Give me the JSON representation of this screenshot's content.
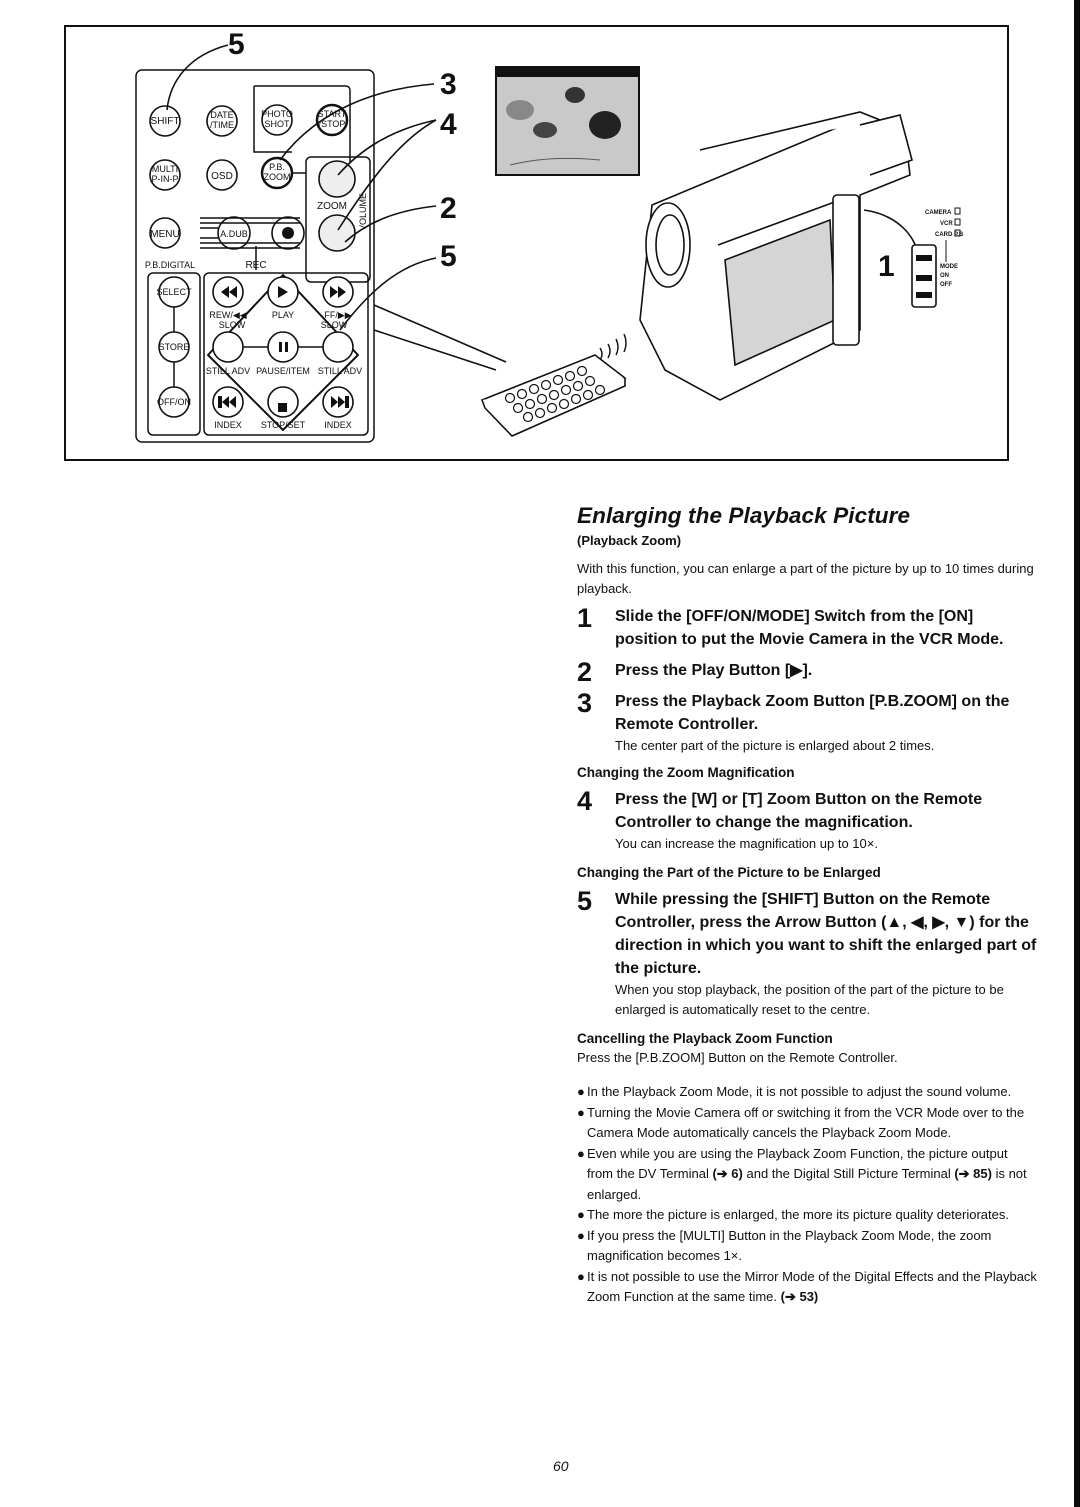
{
  "figure": {
    "callouts": {
      "top_left_5": "5",
      "right_3": "3",
      "right_4": "4",
      "right_2": "2",
      "right_5": "5",
      "switch_1": "1"
    },
    "remote_buttons": {
      "shift": "SHIFT",
      "date_time": [
        "DATE",
        "/TIME"
      ],
      "photo_shot": [
        "PHOTO",
        "SHOT"
      ],
      "start_stop": [
        "START",
        "/STOP"
      ],
      "multi": [
        "MULTI",
        "P-IN-P"
      ],
      "osd": "OSD",
      "pb_zoom": [
        "P.B.",
        "ZOOM"
      ],
      "zoom_label": "ZOOM",
      "volume_label": "VOLUME",
      "menu": "MENU",
      "a_dub": "A.DUB",
      "rec_label": "REC",
      "pb_digital_label": "P.B.DIGITAL",
      "select": "SELECT",
      "store": "STORE",
      "off_on": "OFF/ON",
      "rew_label": "REW/◀◀",
      "play_label": "PLAY",
      "ff_label": "FF/▶▶",
      "slow_left": "SLOW",
      "slow_right": "SLOW",
      "still_adv_left": "STILL ADV",
      "pause_item": "PAUSE/ITEM",
      "still_adv_right": "STILL ADV",
      "index_left": "INDEX",
      "stop_set": "STOP/SET",
      "index_right": "INDEX"
    },
    "switch_labels": {
      "camera": "CAMERA",
      "vcr": "VCR",
      "card_pb": "CARD P.B",
      "mode": "MODE",
      "on": "ON",
      "off": "OFF"
    }
  },
  "article": {
    "title": "Enlarging the Playback Picture",
    "subtitle": "(Playback Zoom)",
    "intro": "With this function, you can enlarge a part of the picture by up to 10 times during playback.",
    "steps": [
      {
        "num": "1",
        "text": "Slide the [OFF/ON/MODE] Switch from the [ON] position to put the Movie Camera in the VCR Mode.",
        "note": ""
      },
      {
        "num": "2",
        "text": "Press the Play Button [▶].",
        "note": ""
      },
      {
        "num": "3",
        "text": "Press the Playback Zoom Button [P.B.ZOOM] on the Remote Controller.",
        "note": "The center part of the picture is enlarged about 2 times."
      },
      {
        "num": "4",
        "text": "Press the [W] or [T] Zoom Button on the Remote Controller to change the magnification.",
        "note": "You can increase the magnification up to 10×."
      },
      {
        "num": "5",
        "text": "While pressing the [SHIFT] Button on the Remote Controller, press the Arrow Button (▲, ◀, ▶, ▼) for the direction in which you want to shift the enlarged part of the picture.",
        "note": "When you stop playback, the position of the part of the picture to be enlarged is automatically reset to the centre."
      }
    ],
    "subheads": {
      "zoom_magnification": "Changing the Zoom Magnification",
      "part_enlarged": "Changing the Part of the Picture to be Enlarged",
      "cancelling": "Cancelling the Playback Zoom Function"
    },
    "cancelling_text": "Press the [P.B.ZOOM] Button on the Remote Controller.",
    "notes": [
      {
        "text": "In the Playback Zoom Mode, it is not possible to adjust the sound volume."
      },
      {
        "text": "Turning the Movie Camera off or switching it from the VCR Mode over to the Camera Mode automatically cancels the Playback Zoom Mode."
      },
      {
        "text_before": "Even while you are using the Playback Zoom Function, the picture output from the DV Terminal ",
        "ref1": "(➔ 6)",
        "text_mid": " and the Digital Still Picture Terminal ",
        "ref2": "(➔ 85)",
        "text_after": " is not enlarged."
      },
      {
        "text": "The more the picture is enlarged, the more its picture quality deteriorates."
      },
      {
        "text": "If you press the [MULTI] Button in the Playback Zoom Mode, the zoom magnification becomes 1×."
      },
      {
        "text_before": "It is not possible to use the Mirror Mode of the Digital Effects and the Playback Zoom Function at the same time. ",
        "ref1": "(➔ 53)"
      }
    ],
    "bullet": "●"
  },
  "page_number": "60"
}
